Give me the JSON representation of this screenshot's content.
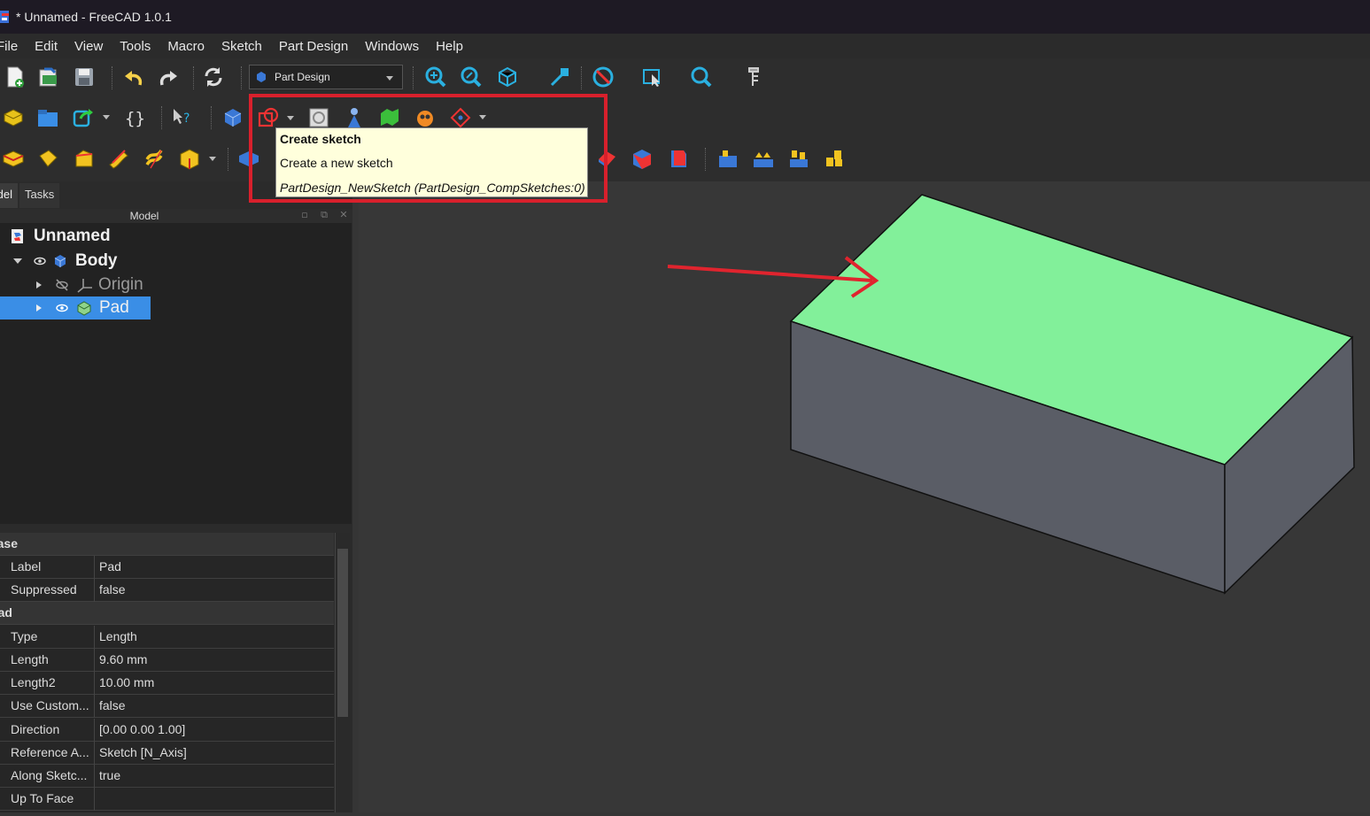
{
  "window": {
    "title": "* Unnamed - FreeCAD 1.0.1"
  },
  "menu": [
    "File",
    "Edit",
    "View",
    "Tools",
    "Macro",
    "Sketch",
    "Part Design",
    "Windows",
    "Help"
  ],
  "toolbar": {
    "workbench_label": "Part Design"
  },
  "panel": {
    "tabs": [
      "Model",
      "Tasks"
    ],
    "header": "Model"
  },
  "tree": {
    "doc": "Unnamed",
    "body": "Body",
    "origin": "Origin",
    "pad": "Pad"
  },
  "properties": {
    "groups": [
      {
        "name": "Base",
        "rows": [
          {
            "k": "Label",
            "v": "Pad"
          },
          {
            "k": "Suppressed",
            "v": "false"
          }
        ]
      },
      {
        "name": "Pad",
        "rows": [
          {
            "k": "Type",
            "v": "Length"
          },
          {
            "k": "Length",
            "v": "9.60 mm"
          },
          {
            "k": "Length2",
            "v": "10.00 mm"
          },
          {
            "k": "Use Custom...",
            "v": "false"
          },
          {
            "k": "Direction",
            "v": "[0.00 0.00 1.00]"
          },
          {
            "k": "Reference A...",
            "v": "Sketch [N_Axis]"
          },
          {
            "k": "Along Sketc...",
            "v": "true"
          },
          {
            "k": "Up To Face",
            "v": ""
          }
        ]
      }
    ]
  },
  "tooltip": {
    "title": "Create sketch",
    "description": "Create a new sketch",
    "command": "PartDesign_NewSketch (PartDesign_CompSketches:0)"
  },
  "colors": {
    "highlight": "#d8202c",
    "top_face": "#82f09a",
    "side_face": "#5a5d66",
    "selection": "#3a8ee6"
  }
}
